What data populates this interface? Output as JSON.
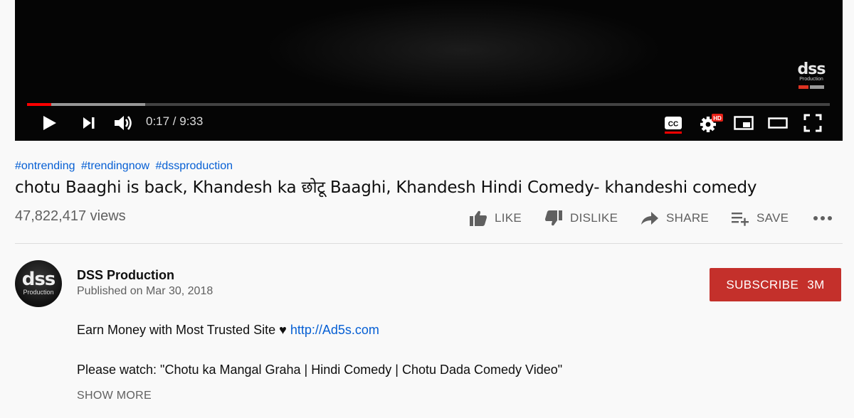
{
  "player": {
    "watermark": {
      "brand": "dss",
      "sub": "Production"
    },
    "time_display": "0:17 / 9:33",
    "progress": {
      "played_fraction": 0.03,
      "buffered_fraction": 0.147
    },
    "controls": [
      "play-icon",
      "next-icon",
      "volume-icon",
      "captions-icon",
      "settings-hd-icon",
      "miniplayer-icon",
      "theater-icon",
      "fullscreen-icon"
    ],
    "hd_badge": "HD",
    "cc_label": "CC"
  },
  "video": {
    "hashtags": [
      "#ontrending",
      "#trendingnow",
      "#dssproduction"
    ],
    "title": "chotu Baaghi is back, Khandesh ka छोटू Baaghi, Khandesh Hindi Comedy- khandeshi comedy",
    "views": "47,822,417 views"
  },
  "actions": {
    "like": "LIKE",
    "dislike": "DISLIKE",
    "share": "SHARE",
    "save": "SAVE"
  },
  "channel": {
    "name": "DSS Production",
    "published": "Published on Mar 30, 2018",
    "avatar_text": "dss",
    "avatar_sub": "Production",
    "subscribe_label": "SUBSCRIBE",
    "subscriber_count": "3M"
  },
  "description": {
    "line1_text": "Earn Money with Most Trusted Site ♥ ",
    "line1_link": "http://Ad5s.com",
    "line2": "Please watch: \"Chotu ka Mangal Graha | Hindi Comedy | Chotu Dada Comedy Video\"",
    "show_more": "SHOW MORE"
  },
  "colors": {
    "link": "#065fd4",
    "subscribe_bg": "#c4302b",
    "progress_played": "#ff0000"
  }
}
